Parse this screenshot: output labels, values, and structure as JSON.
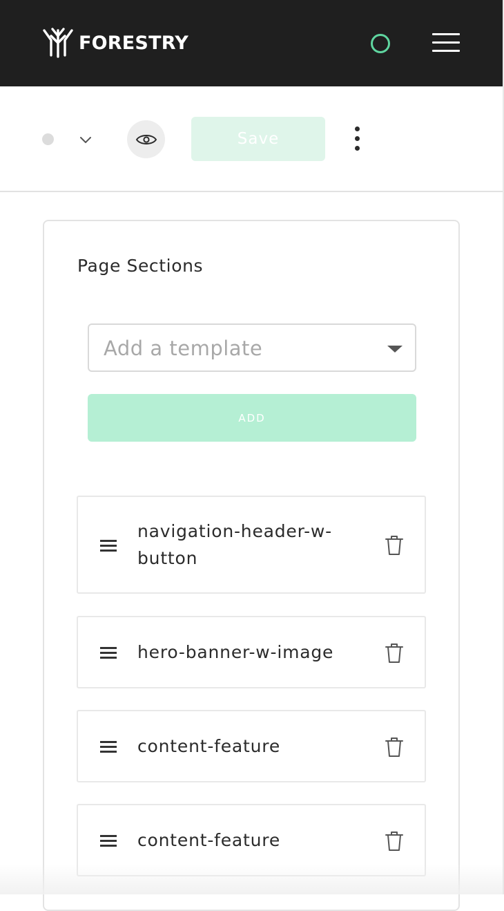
{
  "header": {
    "logo_text": "FORESTRY",
    "logo_icon": "forestry-tree-logo",
    "status_icon": "sync-status-ring",
    "menu_icon": "hamburger-menu-icon"
  },
  "toolbar": {
    "status_icon": "draft-status-dot",
    "status_dropdown_icon": "chevron-down-icon",
    "preview_icon": "eye-icon",
    "save_label": "Save",
    "more_icon": "more-vertical-icon"
  },
  "page_sections": {
    "title": "Page Sections",
    "template_select": {
      "placeholder": "Add a template"
    },
    "add_label": "ADD",
    "items": [
      {
        "label": "navigation-header-w-button"
      },
      {
        "label": "hero-banner-w-image"
      },
      {
        "label": "content-feature"
      },
      {
        "label": "content-feature"
      }
    ]
  },
  "colors": {
    "header_bg": "#1f1f1f",
    "accent_green": "#5fd6a0",
    "add_button_bg": "#b5efd4",
    "save_button_bg": "#dff5ea",
    "border": "#e3e3e3"
  }
}
